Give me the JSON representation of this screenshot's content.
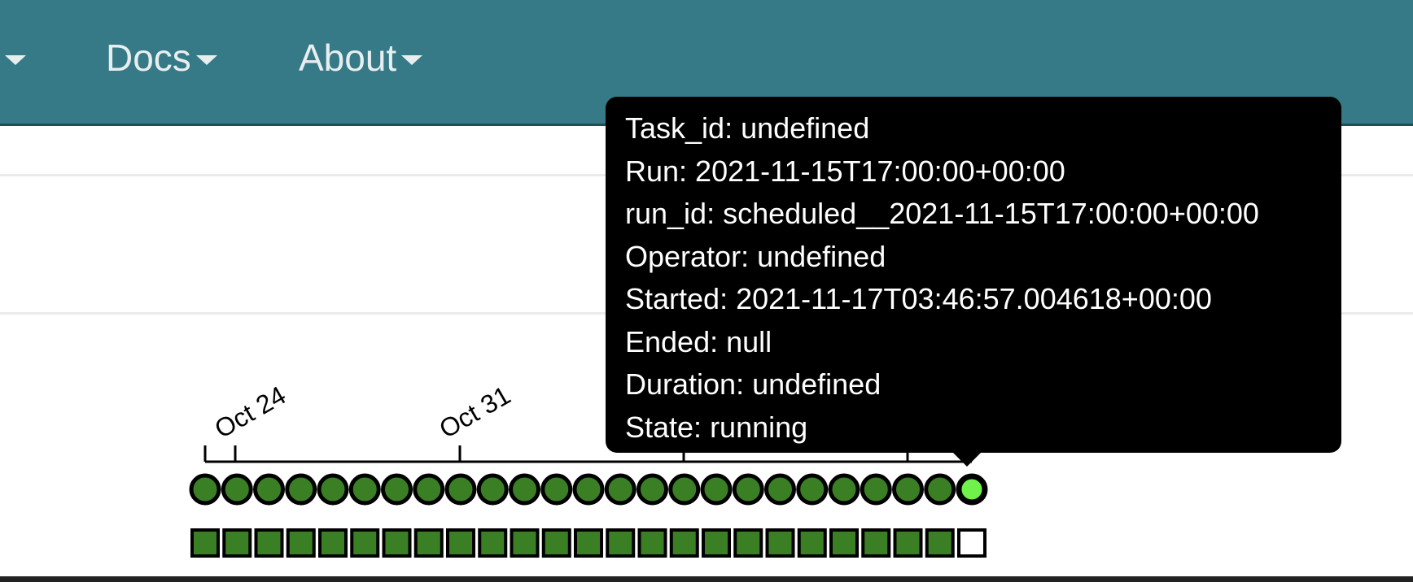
{
  "nav": {
    "items": [
      {
        "label": ""
      },
      {
        "label": "Docs"
      },
      {
        "label": "About"
      }
    ]
  },
  "colors": {
    "navbar": "#357a86",
    "success": "#3b7f25",
    "running": "#6ff34b",
    "queued_empty": "#ffffff"
  },
  "timeline": {
    "tick_labels": [
      "Oct 24",
      "Oct 31"
    ],
    "run_count": 25,
    "run_states": [
      "success",
      "success",
      "success",
      "success",
      "success",
      "success",
      "success",
      "success",
      "success",
      "success",
      "success",
      "success",
      "success",
      "success",
      "success",
      "success",
      "success",
      "success",
      "success",
      "success",
      "success",
      "success",
      "success",
      "success",
      "running"
    ],
    "task_instance_states": [
      "success",
      "success",
      "success",
      "success",
      "success",
      "success",
      "success",
      "success",
      "success",
      "success",
      "success",
      "success",
      "success",
      "success",
      "success",
      "success",
      "success",
      "success",
      "success",
      "success",
      "success",
      "success",
      "success",
      "success",
      "none"
    ]
  },
  "tooltip": {
    "lines": [
      "Task_id: undefined",
      "Run: 2021-11-15T17:00:00+00:00",
      "run_id: scheduled__2021-11-15T17:00:00+00:00",
      "Operator: undefined",
      "Started: 2021-11-17T03:46:57.004618+00:00",
      "Ended: null",
      "Duration: undefined",
      "State: running"
    ]
  }
}
